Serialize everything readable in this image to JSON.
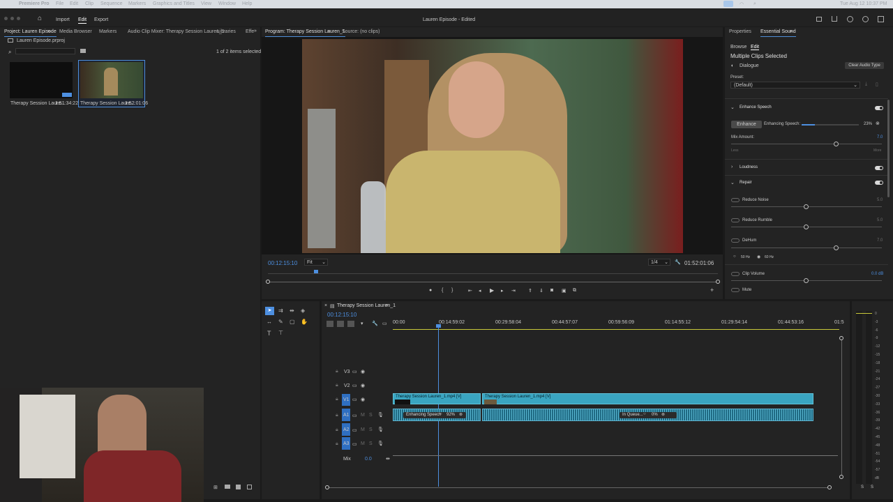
{
  "mac_menu": {
    "app": "Premiere Pro",
    "items": [
      "File",
      "Edit",
      "Clip",
      "Sequence",
      "Markers",
      "Graphics and Titles",
      "View",
      "Window",
      "Help"
    ],
    "clock": "Tue Aug 12  10:37 PM"
  },
  "app_header": {
    "home_label": "⌂",
    "tabs": [
      "Import",
      "Edit",
      "Export"
    ],
    "title": "Lauren Episode",
    "title_status": "Edited"
  },
  "project_panel": {
    "tabs": [
      "Project: Lauren Episode",
      "Media Browser",
      "Markers",
      "Audio Clip Mixer: Therapy Session Lauren_1",
      "Libraries",
      "Effe"
    ],
    "project_file": "Lauren Episode.prproj",
    "items_count": "1 of 2 items selected",
    "items": [
      {
        "name": "Therapy Session Laure...",
        "duration": "1:51:34:22"
      },
      {
        "name": "Therapy Session Laure...",
        "duration": "1:52:01:06"
      }
    ]
  },
  "program_monitor": {
    "tabs": [
      "Program: Therapy Session Lauren_1",
      "Source: (no clips)"
    ],
    "timecode": "00:12:15:10",
    "fit": "Fit",
    "resolution": "1/4",
    "duration": "01:52:01:06"
  },
  "essential_sound": {
    "tabs": [
      "Properties",
      "Essential Sound"
    ],
    "subtabs": [
      "Browse",
      "Edit"
    ],
    "heading": "Multiple Clips Selected",
    "type": "Dialogue",
    "clear_button": "Clear Audio Type",
    "preset_label": "Preset:",
    "preset_value": "(Default)",
    "enhance_speech": {
      "label": "Enhance Speech",
      "button": "Enhance",
      "status": "Enhancing Speech:",
      "percent": "23%",
      "progress": 0.23,
      "mix_label": "Mix Amount:",
      "mix_value": "7.0",
      "less": "Less",
      "more": "More",
      "mix_level": 0.7
    },
    "loudness": "Loudness",
    "repair": "Repair",
    "repair_items": [
      {
        "label": "Reduce Noise",
        "value": "5.0",
        "level": 0.5
      },
      {
        "label": "Reduce Rumble",
        "value": "5.0",
        "level": 0.5
      },
      {
        "label": "DeHum",
        "value": "7.0",
        "level": 0.7
      }
    ],
    "hz": [
      "50 Hz",
      "60 Hz"
    ],
    "clip_volume": {
      "label": "Clip Volume",
      "value": "0.0 dB",
      "level": 0.5
    },
    "mute": "Mute"
  },
  "timeline": {
    "sequence": "Therapy Session Lauren_1",
    "timecode": "00:12:15:10",
    "ruler": [
      "00:00",
      "00:14:59:02",
      "00:29:58:04",
      "00:44:57:07",
      "00:59:56:09",
      "01:14:55:12",
      "01:29:54:14",
      "01:44:53:16",
      "01:5"
    ],
    "video_tracks": [
      "V3",
      "V2",
      "V1"
    ],
    "audio_tracks": [
      "A1",
      "A2",
      "A3"
    ],
    "mix_label": "Mix",
    "mix_value": "0.0",
    "clip_v1a": "Therapy Session Lauren_1.mp4 [V]",
    "clip_v1b": "Therapy Session Lauren_1.mp4 [V]",
    "audio_status_1": "Enhancing Speech",
    "audio_pct_1": "92%",
    "audio_status_2": "In Queue...",
    "audio_pct_2": "0%"
  },
  "meter_labels": [
    "0",
    "-3",
    "-6",
    "-9",
    "-12",
    "-15",
    "-18",
    "-21",
    "-24",
    "-27",
    "-30",
    "-33",
    "-36",
    "-39",
    "-42",
    "-45",
    "-48",
    "-51",
    "-54",
    "-57",
    "dB"
  ],
  "meter_footer": [
    "S",
    "S"
  ]
}
